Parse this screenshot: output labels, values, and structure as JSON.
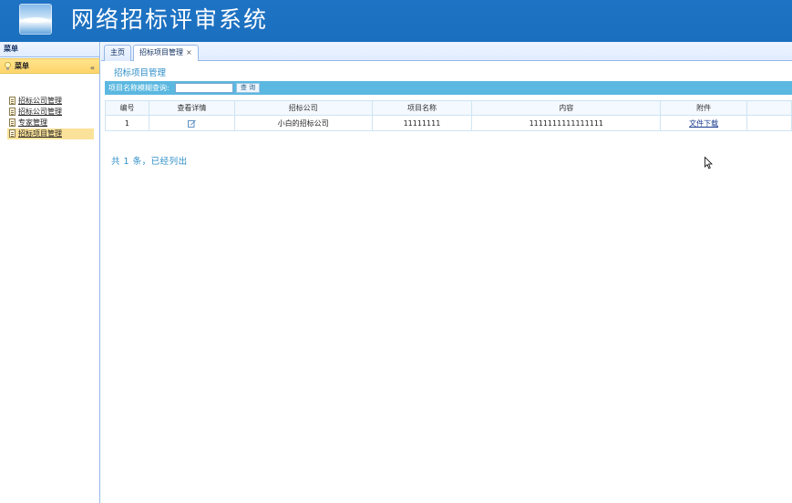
{
  "header": {
    "title": "网络招标评审系统"
  },
  "sidebar": {
    "title": "菜单",
    "accordion_title": "菜单",
    "items": [
      {
        "label": "招标公司管理"
      },
      {
        "label": "招标公司管理"
      },
      {
        "label": "专家管理"
      },
      {
        "label": "招标项目管理"
      }
    ]
  },
  "tabs": [
    {
      "label": "主页"
    },
    {
      "label": "招标项目管理",
      "close": "×"
    }
  ],
  "page": {
    "heading": "招标项目管理",
    "search": {
      "label": "项目名称模糊查询:",
      "value": "",
      "button": "查 询"
    },
    "table": {
      "columns": [
        "编号",
        "查看详情",
        "招标公司",
        "项目名称",
        "内容",
        "附件"
      ],
      "rows": [
        {
          "id": "1",
          "company": "小白的招标公司",
          "project": "11111111",
          "content": "1111111111111111",
          "attachment": "文件下载"
        }
      ]
    },
    "footer": "共 1 条，已经列出"
  },
  "colors": {
    "header": "#1a6fbe",
    "accent": "#2e8ec7",
    "search_bar": "#5bb8e0",
    "selected": "#fbe29a"
  }
}
